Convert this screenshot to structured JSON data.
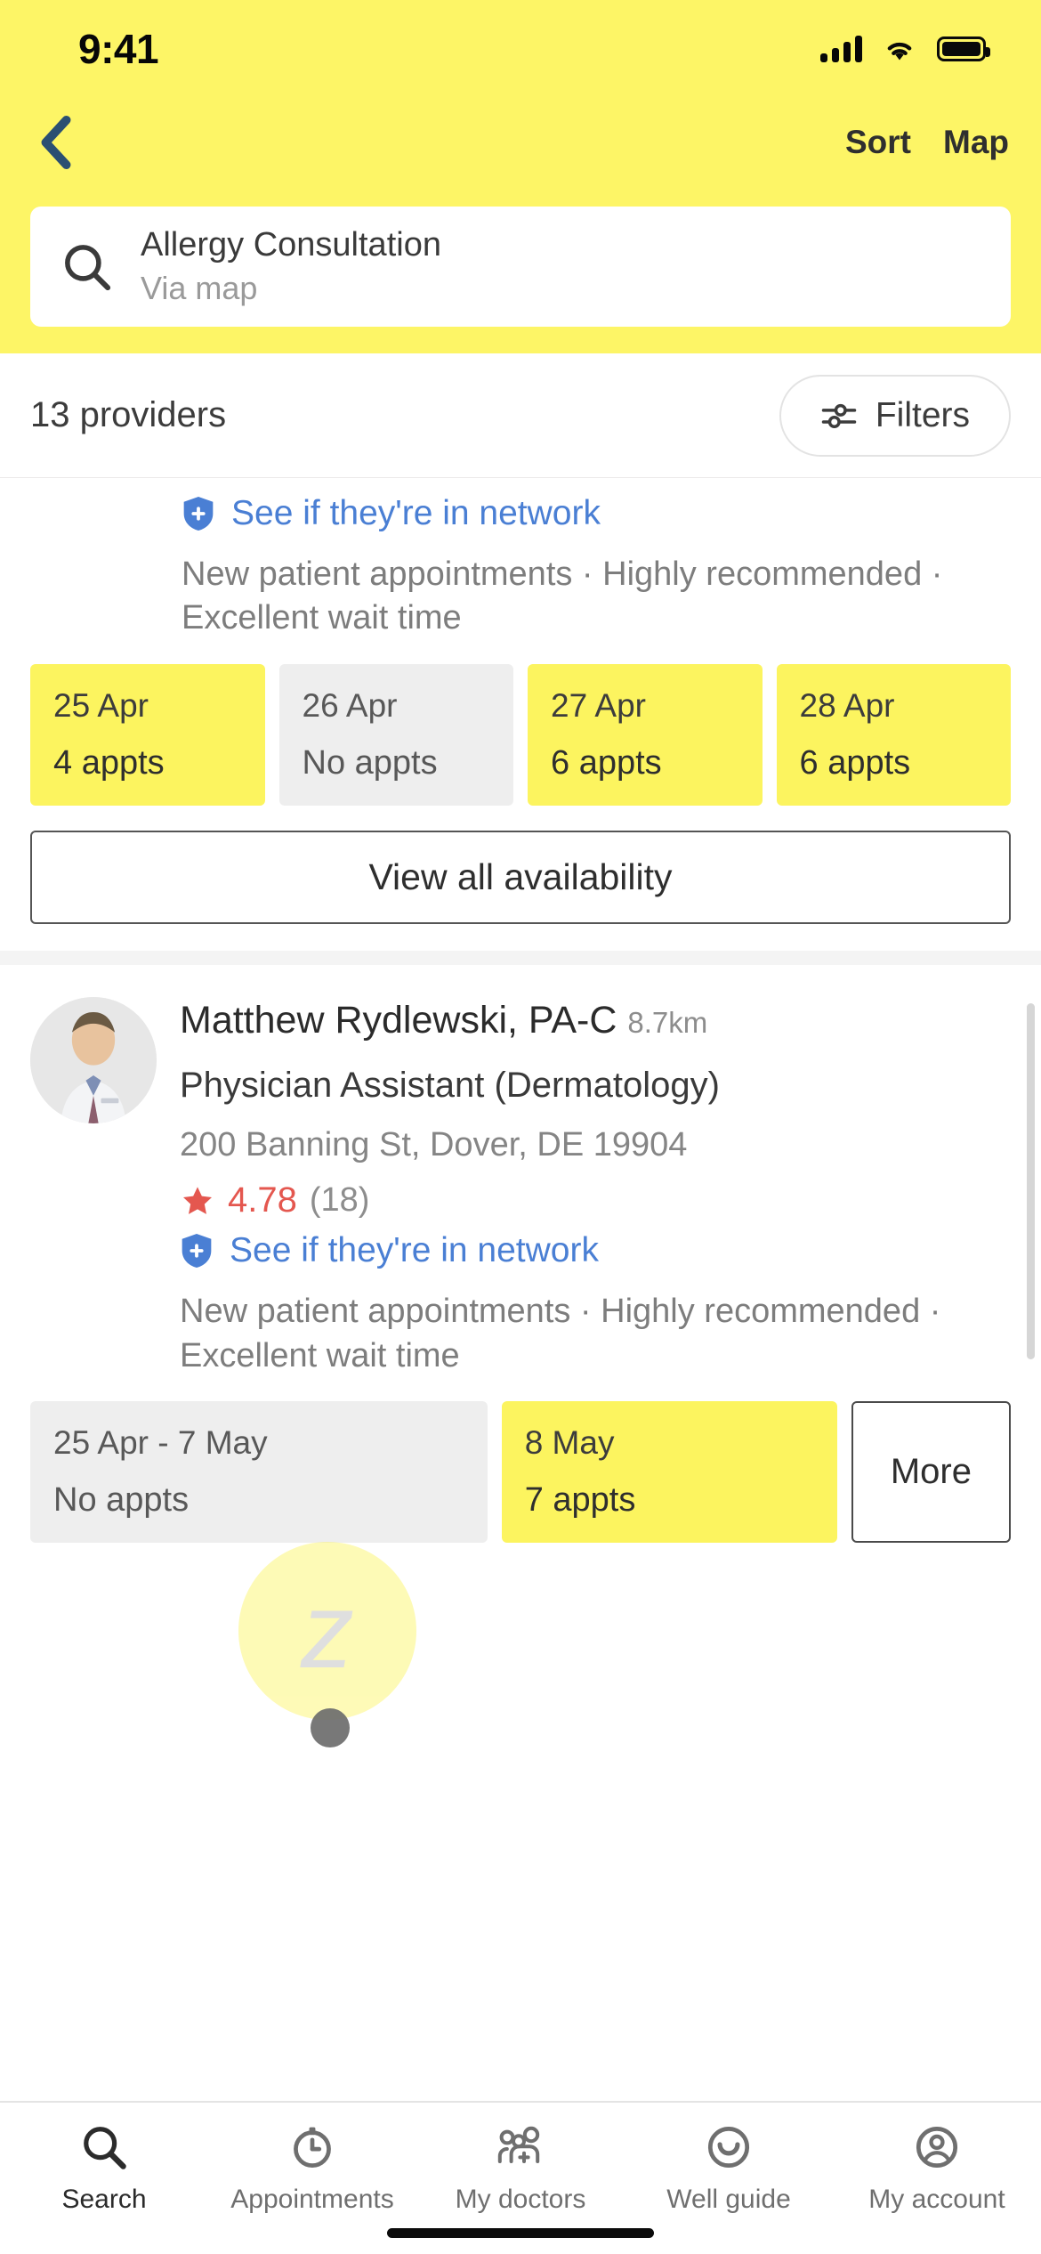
{
  "status_bar": {
    "time": "9:41",
    "icons": [
      "signal-bars-icon",
      "wifi-icon",
      "battery-icon"
    ]
  },
  "nav": {
    "back_icon": "chevron-left-icon",
    "sort_label": "Sort",
    "map_label": "Map"
  },
  "search": {
    "icon": "search-icon",
    "value": "Allergy Consultation",
    "subtext": "Via map"
  },
  "results": {
    "count_label": "13 providers",
    "filters_label": "Filters",
    "filters_icon": "tune-sliders-icon"
  },
  "colors": {
    "brand_yellow": "#fdf566",
    "tile_yellow": "#fcf45f",
    "tile_gray": "#eeeeee",
    "link_blue": "#4a7fd4",
    "rating_red": "#e4574f"
  },
  "cards": [
    {
      "network_link": "See if they're in network",
      "network_icon": "shield-plus-icon",
      "blurb": "New patient appointments · Highly recommended · Excellent wait time",
      "slots": [
        {
          "date": "25 Apr",
          "appts": "4 appts",
          "available": true
        },
        {
          "date": "26 Apr",
          "appts": "No appts",
          "available": false
        },
        {
          "date": "27 Apr",
          "appts": "6 appts",
          "available": true
        },
        {
          "date": "28 Apr",
          "appts": "6 appts",
          "available": true
        }
      ],
      "view_all_label": "View all availability"
    },
    {
      "name": "Matthew Rydlewski, PA-C",
      "distance": "8.7km",
      "role": "Physician Assistant (Dermatology)",
      "address": "200 Banning St, Dover, DE 19904",
      "rating_value": "4.78",
      "rating_count": "(18)",
      "rating_icon": "star-icon",
      "network_link": "See if they're in network",
      "network_icon": "shield-plus-icon",
      "blurb": "New patient appointments · Highly recommended · Excellent wait time",
      "slots": [
        {
          "date": "25 Apr - 7 May",
          "appts": "No appts",
          "available": false
        },
        {
          "date": "8 May",
          "appts": "7 appts",
          "available": true
        }
      ],
      "more_label": "More"
    }
  ],
  "tabbar": [
    {
      "label": "Search",
      "icon": "search-icon",
      "active": true
    },
    {
      "label": "Appointments",
      "icon": "clock-icon",
      "active": false
    },
    {
      "label": "My doctors",
      "icon": "people-plus-icon",
      "active": false
    },
    {
      "label": "Well guide",
      "icon": "smiley-icon",
      "active": false
    },
    {
      "label": "My account",
      "icon": "account-circle-icon",
      "active": false
    }
  ]
}
